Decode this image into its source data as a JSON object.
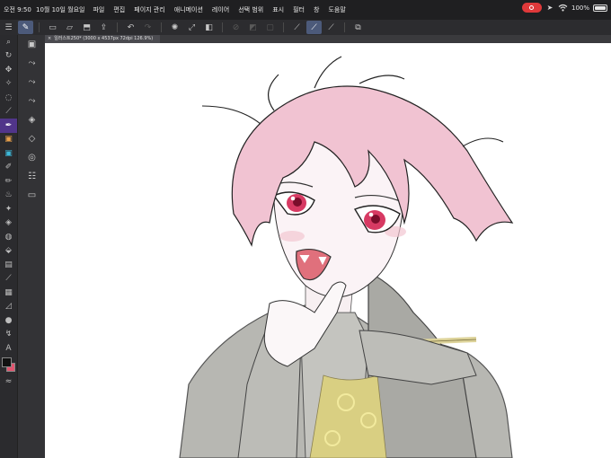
{
  "status": {
    "time": "오전 9:50",
    "date": "10월 10일 월요일",
    "battery": "100%"
  },
  "menu": [
    "파일",
    "편집",
    "페이지 관리",
    "애니메이션",
    "레이어",
    "선택 범위",
    "표시",
    "필터",
    "창",
    "도움말"
  ],
  "document_tab": {
    "title": "일러스트250* (3000 x 4537px 72dpi 126.9%)"
  },
  "icons": {
    "status": [
      "record-icon",
      "chevron-icon",
      "wifi-icon",
      "battery-icon"
    ],
    "command_bar": [
      "menu-icon",
      "pen-tool-icon",
      "new-file-icon",
      "open-file-icon",
      "save-icon",
      "export-icon",
      "undo-icon",
      "redo-icon",
      "loading-icon",
      "transform-icon",
      "fill-icon",
      "screen-tone-icon",
      "border-icon",
      "line-stroke-icon",
      "stabilizer-icon",
      "line-thin-icon",
      "erase-icon"
    ],
    "left_tools": [
      "zoom-icon",
      "rotate-icon",
      "move-layer-icon",
      "selection-icon",
      "lasso-icon",
      "eyedropper-icon",
      "pen-icon",
      "airbrush-color-icon",
      "paint-icon",
      "brush-icon",
      "pencil-icon",
      "ink-brush-icon",
      "marker-icon",
      "eraser-icon",
      "blend-icon",
      "fill-bucket-icon",
      "gradient-icon",
      "line-icon",
      "frame-icon",
      "ruler-icon",
      "dot-icon",
      "correction-icon",
      "text-icon"
    ],
    "sub_tools": [
      "sub-tool-icon",
      "brush-stroke-icon",
      "brush-stroke-icon",
      "brush-stroke-icon",
      "layer-icon",
      "layer-property-icon",
      "material-icon",
      "palette-icon",
      "timeline-icon"
    ]
  },
  "colors": {
    "main": "#111111",
    "sub": "#e0556f",
    "selected_tool": "#51358a",
    "active_command": "#4c5a7a"
  }
}
